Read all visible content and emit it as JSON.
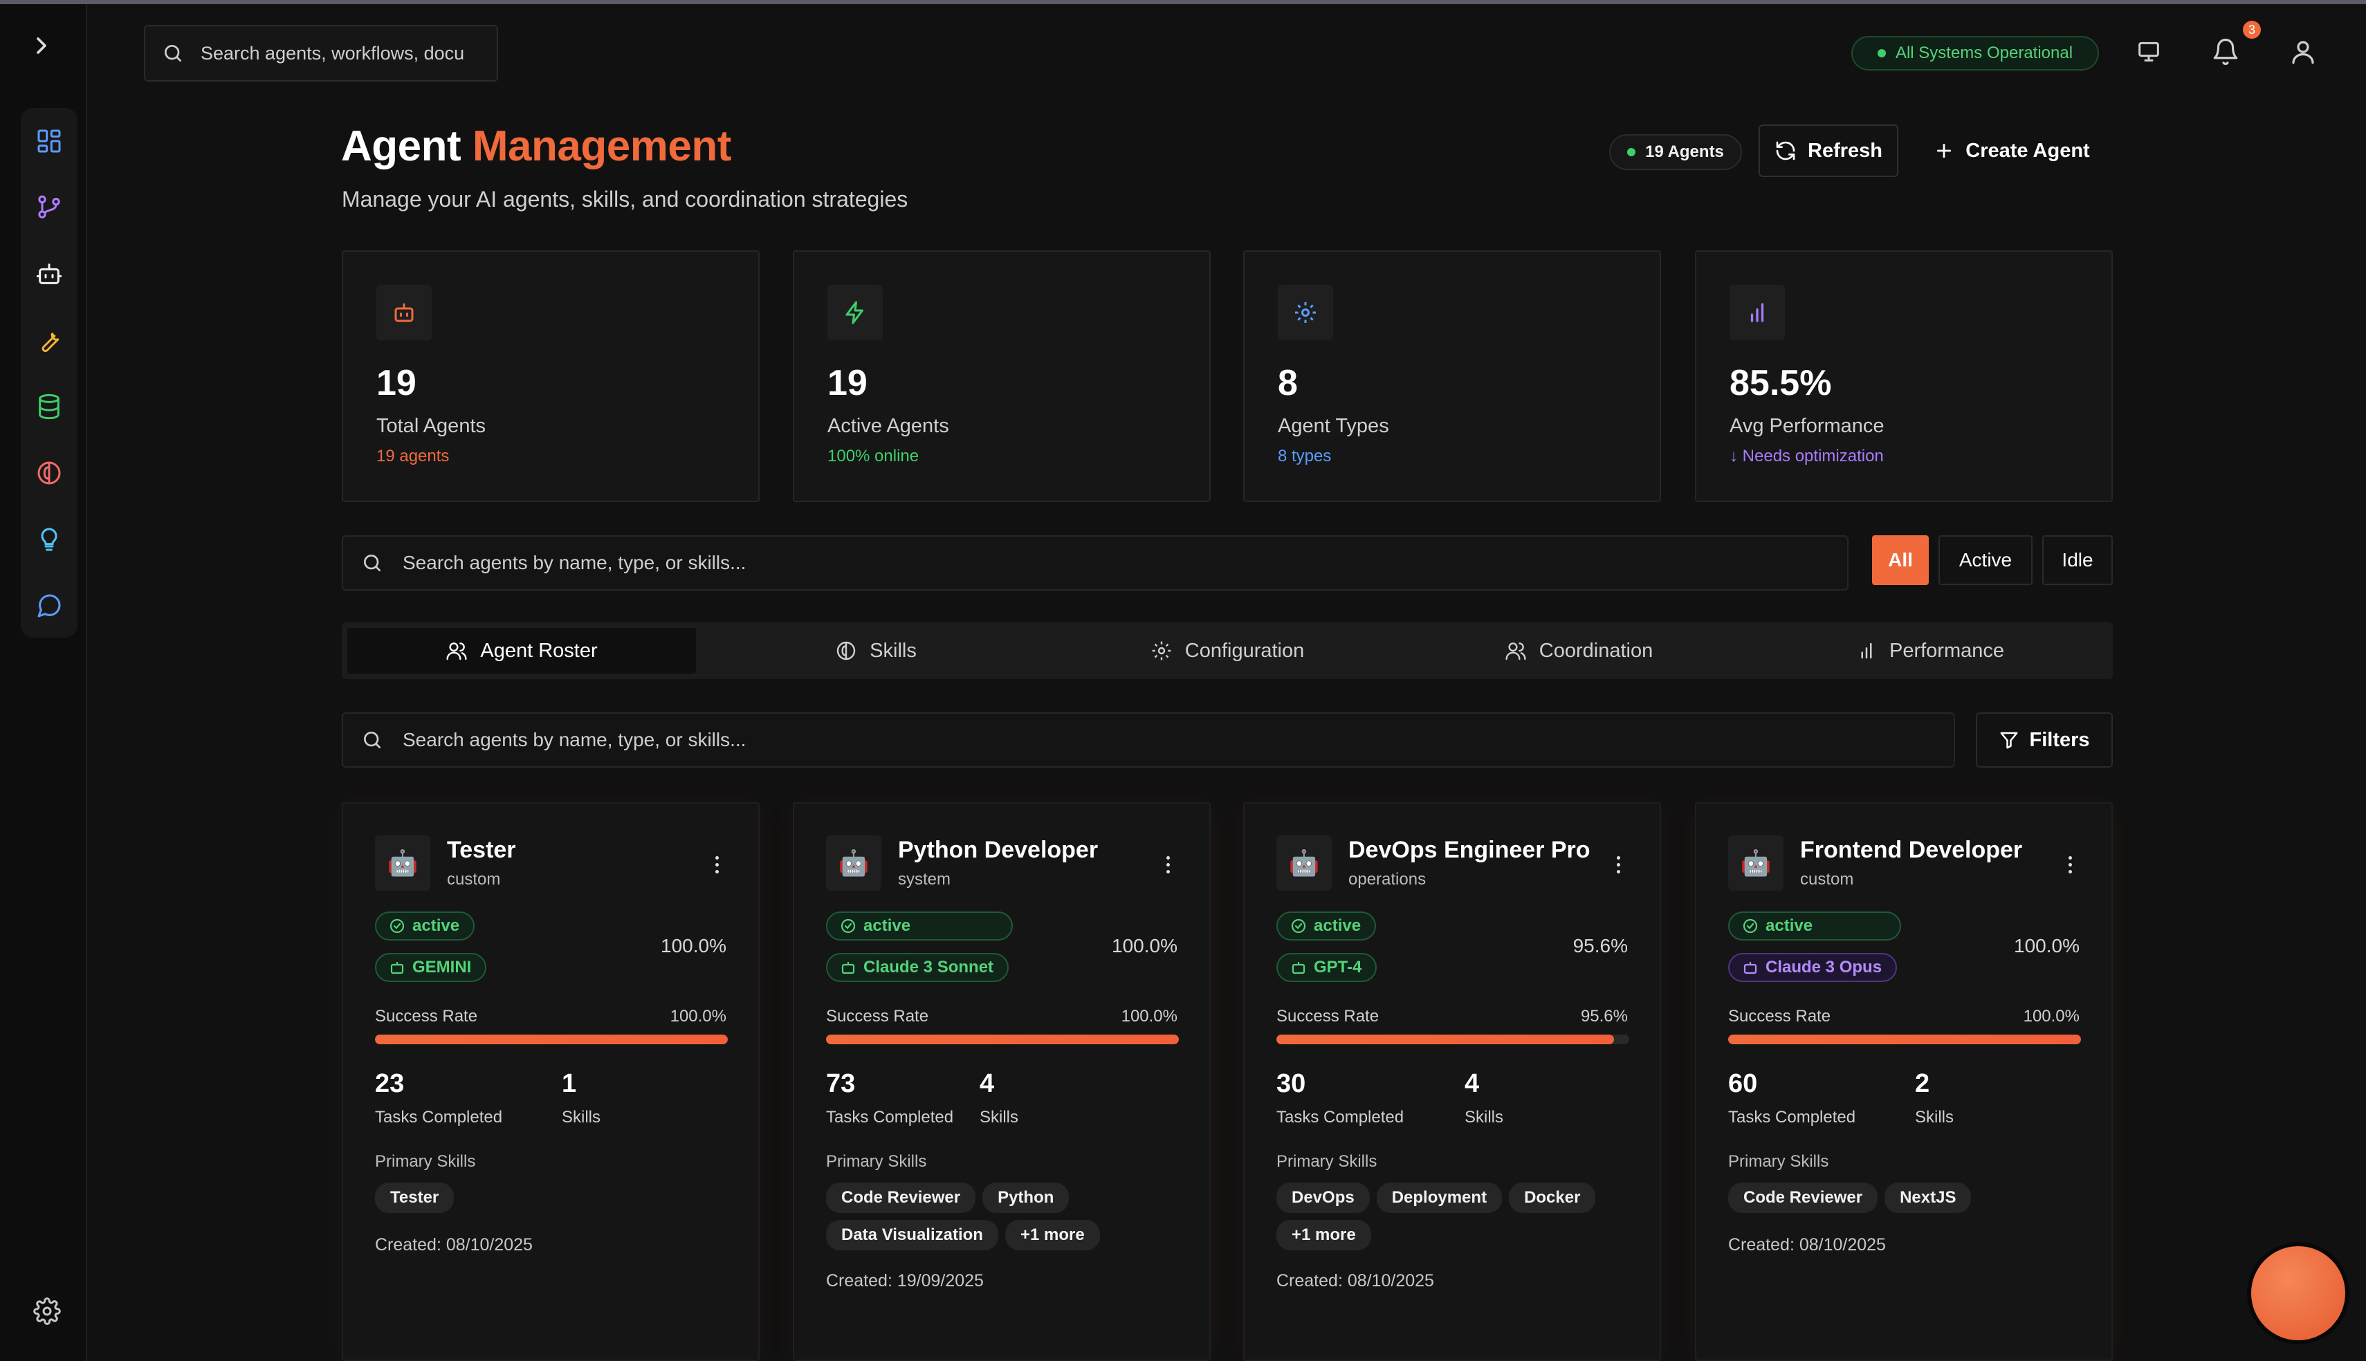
{
  "header": {
    "search_placeholder": "Search agents, workflows, docu",
    "system_status": "All Systems Operational",
    "notification_count": "3"
  },
  "page": {
    "title_main": "Agent",
    "title_accent": "Management",
    "subtitle": "Manage your AI agents, skills, and coordination strategies",
    "agents_count_label": "19 Agents",
    "refresh_label": "Refresh",
    "create_label": "Create Agent"
  },
  "stats": [
    {
      "icon": "robot-icon",
      "value": "19",
      "label": "Total Agents",
      "sub": "19 agents",
      "sub_color": "#f06a3c"
    },
    {
      "icon": "lightning-icon",
      "value": "19",
      "label": "Active Agents",
      "sub": "100% online",
      "sub_color": "#3ecf6a"
    },
    {
      "icon": "gear-icon",
      "value": "8",
      "label": "Agent Types",
      "sub": "8 types",
      "sub_color": "#5b9dff"
    },
    {
      "icon": "bar-chart-icon",
      "value": "85.5%",
      "label": "Avg Performance",
      "sub": "↓ Needs optimization",
      "sub_color": "#a77bff"
    }
  ],
  "filters": {
    "search_placeholder": "Search agents by name, type, or skills...",
    "options": [
      "All",
      "Active",
      "Idle"
    ],
    "selected": "All"
  },
  "tabs": [
    {
      "label": "Agent Roster",
      "icon": "users-icon"
    },
    {
      "label": "Skills",
      "icon": "brain-icon"
    },
    {
      "label": "Configuration",
      "icon": "gear-icon"
    },
    {
      "label": "Coordination",
      "icon": "group-icon"
    },
    {
      "label": "Performance",
      "icon": "bar-chart-icon"
    }
  ],
  "roster": {
    "search_placeholder": "Search agents by name, type, or skills...",
    "filters_label": "Filters"
  },
  "labels": {
    "success_rate": "Success Rate",
    "tasks_completed": "Tasks Completed",
    "skills": "Skills",
    "primary_skills": "Primary Skills"
  },
  "agents": [
    {
      "name": "Tester",
      "type": "custom",
      "status": "active",
      "model": "GEMINI",
      "model_color": "green",
      "performance": "100.0%",
      "success_rate": "100.0%",
      "success_fraction": 1.0,
      "tasks": "23",
      "skills_count": "1",
      "skills": [
        "Tester"
      ],
      "created": "Created: 08/10/2025"
    },
    {
      "name": "Python Developer",
      "type": "system",
      "status": "active",
      "model": "Claude 3 Sonnet",
      "model_color": "green",
      "performance": "100.0%",
      "success_rate": "100.0%",
      "success_fraction": 1.0,
      "tasks": "73",
      "skills_count": "4",
      "skills": [
        "Code Reviewer",
        "Python",
        "Data Visualization",
        "+1 more"
      ],
      "created": "Created: 19/09/2025"
    },
    {
      "name": "DevOps Engineer Pro",
      "type": "operations",
      "status": "active",
      "model": "GPT-4",
      "model_color": "green",
      "performance": "95.6%",
      "success_rate": "95.6%",
      "success_fraction": 0.956,
      "tasks": "30",
      "skills_count": "4",
      "skills": [
        "DevOps",
        "Deployment",
        "Docker",
        "+1 more"
      ],
      "created": "Created: 08/10/2025"
    },
    {
      "name": "Frontend Developer",
      "type": "custom",
      "status": "active",
      "model": "Claude 3 Opus",
      "model_color": "purple",
      "performance": "100.0%",
      "success_rate": "100.0%",
      "success_fraction": 1.0,
      "tasks": "60",
      "skills_count": "2",
      "skills": [
        "Code Reviewer",
        "NextJS"
      ],
      "created": "Created: 08/10/2025"
    }
  ]
}
